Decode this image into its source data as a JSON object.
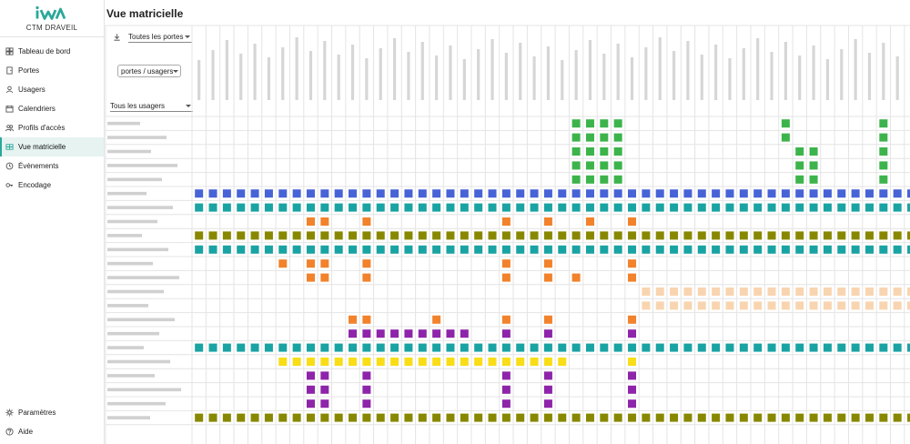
{
  "app": {
    "brand": "CTM DRAVEIL",
    "page_title": "Vue matricielle"
  },
  "nav": {
    "top": [
      {
        "label": "Tableau de bord",
        "icon": "dashboard-icon"
      },
      {
        "label": "Portes",
        "icon": "door-icon"
      },
      {
        "label": "Usagers",
        "icon": "user-icon"
      },
      {
        "label": "Calendriers",
        "icon": "calendar-icon"
      },
      {
        "label": "Profils d'accès",
        "icon": "users-icon"
      },
      {
        "label": "Vue matricielle",
        "icon": "grid-icon",
        "active": true
      },
      {
        "label": "Évènements",
        "icon": "history-icon"
      },
      {
        "label": "Encodage",
        "icon": "key-icon"
      }
    ],
    "bottom": [
      {
        "label": "Paramètres",
        "icon": "gear-icon"
      },
      {
        "label": "Aide",
        "icon": "help-icon"
      }
    ]
  },
  "filters": {
    "doors": "Toutes les portes",
    "mode": "portes / usagers",
    "users": "Tous les usagers"
  },
  "colors": {
    "accent": "#2aa89a",
    "green": "#3cb44b",
    "blue": "#4763d6",
    "teal": "#1aa3a3",
    "orange": "#f2822b",
    "olive": "#888800",
    "peach": "#f8d5b0",
    "purple": "#8e24aa",
    "yellow": "#f9dd16",
    "grid": "#e4e4e4"
  },
  "matrix": {
    "columns": 52,
    "rows": [
      {
        "color": "green",
        "cols": [
          27,
          28,
          29,
          30,
          42,
          49
        ]
      },
      {
        "color": "green",
        "cols": [
          27,
          28,
          29,
          30,
          42,
          49
        ]
      },
      {
        "color": "green",
        "cols": [
          27,
          28,
          29,
          30,
          43,
          44,
          49
        ]
      },
      {
        "color": "green",
        "cols": [
          27,
          28,
          29,
          30,
          43,
          44,
          49
        ]
      },
      {
        "color": "green",
        "cols": [
          27,
          28,
          29,
          30,
          43,
          44,
          49
        ]
      },
      {
        "color": "blue",
        "all": true
      },
      {
        "color": "teal",
        "all": true
      },
      {
        "color": "orange",
        "cols": [
          8,
          9,
          12,
          22,
          25,
          28,
          31
        ]
      },
      {
        "color": "olive",
        "all": true
      },
      {
        "color": "teal",
        "all": true
      },
      {
        "color": "orange",
        "cols": [
          6,
          8,
          9,
          12,
          22,
          25,
          31
        ]
      },
      {
        "color": "orange",
        "cols": [
          8,
          9,
          12,
          22,
          25,
          27,
          31
        ]
      },
      {
        "color": "peach",
        "from": 32
      },
      {
        "color": "peach",
        "from": 32
      },
      {
        "color": "orange",
        "cols": [
          11,
          12,
          17,
          22,
          25,
          31
        ]
      },
      {
        "color": "purple",
        "cols": [
          11,
          12,
          13,
          14,
          15,
          16,
          17,
          18,
          19,
          22,
          25,
          31
        ]
      },
      {
        "color": "teal",
        "all": true
      },
      {
        "color": "yellow",
        "range": [
          6,
          26
        ],
        "cols": [
          31
        ]
      },
      {
        "color": "purple",
        "cols": [
          8,
          9,
          12,
          22,
          25,
          31
        ]
      },
      {
        "color": "purple",
        "cols": [
          8,
          9,
          12,
          22,
          25,
          31
        ]
      },
      {
        "color": "purple",
        "cols": [
          8,
          9,
          12,
          22,
          25,
          31
        ]
      },
      {
        "color": "olive",
        "all": true
      }
    ]
  }
}
